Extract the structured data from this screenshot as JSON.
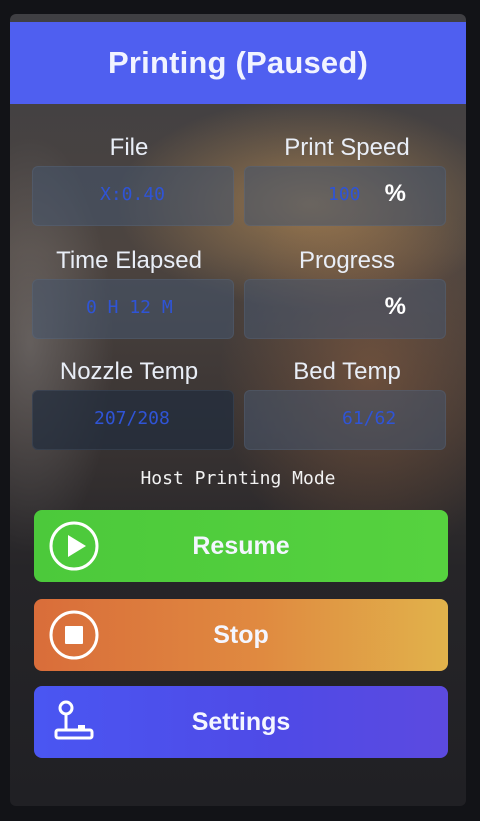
{
  "title": "Printing (Paused)",
  "fields": {
    "file": {
      "label": "File",
      "value": "X:0.40"
    },
    "print_speed": {
      "label": "Print Speed",
      "value": "100",
      "unit": "%"
    },
    "time_elapsed": {
      "label": "Time Elapsed",
      "value": "0 H 12 M"
    },
    "progress": {
      "label": "Progress",
      "value": "",
      "unit": "%"
    },
    "nozzle_temp": {
      "label": "Nozzle Temp",
      "value": "207/208"
    },
    "bed_temp": {
      "label": "Bed Temp",
      "value": "61/62"
    }
  },
  "mode_text": "Host Printing Mode",
  "buttons": {
    "resume": {
      "label": "Resume",
      "icon": "play-circle-icon"
    },
    "stop": {
      "label": "Stop",
      "icon": "stop-circle-icon"
    },
    "settings": {
      "label": "Settings",
      "icon": "joystick-icon"
    }
  },
  "colors": {
    "title_bar": "#4f5ff0",
    "resume": "#4cc93b",
    "stop": "#d96d3a",
    "settings": "#4a56f2",
    "value_text": "#2f54d6"
  }
}
